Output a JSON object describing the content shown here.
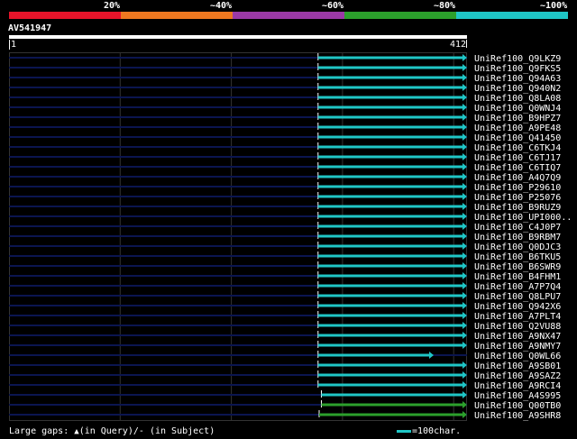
{
  "score_legend": {
    "labels": [
      "20%",
      "~40%",
      "~60%",
      "~80%",
      "~100%"
    ],
    "colors": [
      "#e6142a",
      "#ee7820",
      "#9b39a6",
      "#2ca02c",
      "#1fc6c6"
    ]
  },
  "query": {
    "name": "AV541947",
    "start": "1",
    "end": "412",
    "length": 412
  },
  "hit_line_color": "#0b1550",
  "grid_color": "#333333",
  "hits": [
    {
      "label": "UniRef100_Q9LKZ9",
      "start": 278,
      "end": 412,
      "color": "#1fc6c6"
    },
    {
      "label": "UniRef100_Q9FKS5",
      "start": 278,
      "end": 412,
      "color": "#1fc6c6"
    },
    {
      "label": "UniRef100_Q94A63",
      "start": 278,
      "end": 412,
      "color": "#1fc6c6"
    },
    {
      "label": "UniRef100_Q940N2",
      "start": 278,
      "end": 412,
      "color": "#1fc6c6"
    },
    {
      "label": "UniRef100_Q8LA08",
      "start": 278,
      "end": 412,
      "color": "#1fc6c6"
    },
    {
      "label": "UniRef100_Q0WNJ4",
      "start": 278,
      "end": 412,
      "color": "#1fc6c6"
    },
    {
      "label": "UniRef100_B9HPZ7",
      "start": 278,
      "end": 412,
      "color": "#1fc6c6"
    },
    {
      "label": "UniRef100_A9PE48",
      "start": 278,
      "end": 412,
      "color": "#1fc6c6"
    },
    {
      "label": "UniRef100_Q41450",
      "start": 278,
      "end": 412,
      "color": "#1fc6c6"
    },
    {
      "label": "UniRef100_C6TKJ4",
      "start": 278,
      "end": 412,
      "color": "#1fc6c6"
    },
    {
      "label": "UniRef100_C6TJ17",
      "start": 278,
      "end": 412,
      "color": "#1fc6c6"
    },
    {
      "label": "UniRef100_C6TIQ7",
      "start": 278,
      "end": 412,
      "color": "#1fc6c6"
    },
    {
      "label": "UniRef100_A4Q7Q9",
      "start": 278,
      "end": 412,
      "color": "#1fc6c6"
    },
    {
      "label": "UniRef100_P29610",
      "start": 278,
      "end": 412,
      "color": "#1fc6c6"
    },
    {
      "label": "UniRef100_P25076",
      "start": 278,
      "end": 412,
      "color": "#1fc6c6"
    },
    {
      "label": "UniRef100_B9RUZ9",
      "start": 278,
      "end": 412,
      "color": "#1fc6c6"
    },
    {
      "label": "UniRef100_UPI000..",
      "start": 278,
      "end": 412,
      "color": "#1fc6c6"
    },
    {
      "label": "UniRef100_C4J0P7",
      "start": 278,
      "end": 412,
      "color": "#1fc6c6"
    },
    {
      "label": "UniRef100_B9RBM7",
      "start": 278,
      "end": 412,
      "color": "#1fc6c6"
    },
    {
      "label": "UniRef100_Q0DJC3",
      "start": 278,
      "end": 412,
      "color": "#1fc6c6"
    },
    {
      "label": "UniRef100_B6TKU5",
      "start": 278,
      "end": 412,
      "color": "#1fc6c6"
    },
    {
      "label": "UniRef100_B6SWR9",
      "start": 278,
      "end": 412,
      "color": "#1fc6c6"
    },
    {
      "label": "UniRef100_B4FHM1",
      "start": 278,
      "end": 412,
      "color": "#1fc6c6"
    },
    {
      "label": "UniRef100_A7P7Q4",
      "start": 278,
      "end": 412,
      "color": "#1fc6c6"
    },
    {
      "label": "UniRef100_Q8LPU7",
      "start": 278,
      "end": 412,
      "color": "#1fc6c6"
    },
    {
      "label": "UniRef100_Q942X6",
      "start": 278,
      "end": 412,
      "color": "#1fc6c6"
    },
    {
      "label": "UniRef100_A7PLT4",
      "start": 278,
      "end": 412,
      "color": "#1fc6c6"
    },
    {
      "label": "UniRef100_Q2VU88",
      "start": 278,
      "end": 412,
      "color": "#1fc6c6"
    },
    {
      "label": "UniRef100_A9NX47",
      "start": 278,
      "end": 412,
      "color": "#1fc6c6"
    },
    {
      "label": "UniRef100_A9NMY7",
      "start": 278,
      "end": 412,
      "color": "#1fc6c6"
    },
    {
      "label": "UniRef100_Q0WL66",
      "start": 278,
      "end": 382,
      "color": "#1fc6c6"
    },
    {
      "label": "UniRef100_A9SB01",
      "start": 278,
      "end": 412,
      "color": "#1fc6c6"
    },
    {
      "label": "UniRef100_A9SAZ2",
      "start": 278,
      "end": 412,
      "color": "#1fc6c6"
    },
    {
      "label": "UniRef100_A9RCI4",
      "start": 278,
      "end": 412,
      "color": "#1fc6c6"
    },
    {
      "label": "UniRef100_A4S995",
      "start": 281,
      "end": 412,
      "color": "#1fc6c6"
    },
    {
      "label": "UniRef100_Q00TB0",
      "start": 281,
      "end": 412,
      "color": "#2ca02c"
    },
    {
      "label": "UniRef100_A9SHR8",
      "start": 279,
      "end": 412,
      "color": "#2ca02c"
    }
  ],
  "footer": {
    "gaps_prefix": "Large gaps:",
    "gaps_query_symbol": "▲",
    "gaps_query_text": "(in Query)/",
    "gaps_subject_symbol": "-",
    "gaps_subject_text": " (in Subject)",
    "scale_text": "=100char."
  }
}
